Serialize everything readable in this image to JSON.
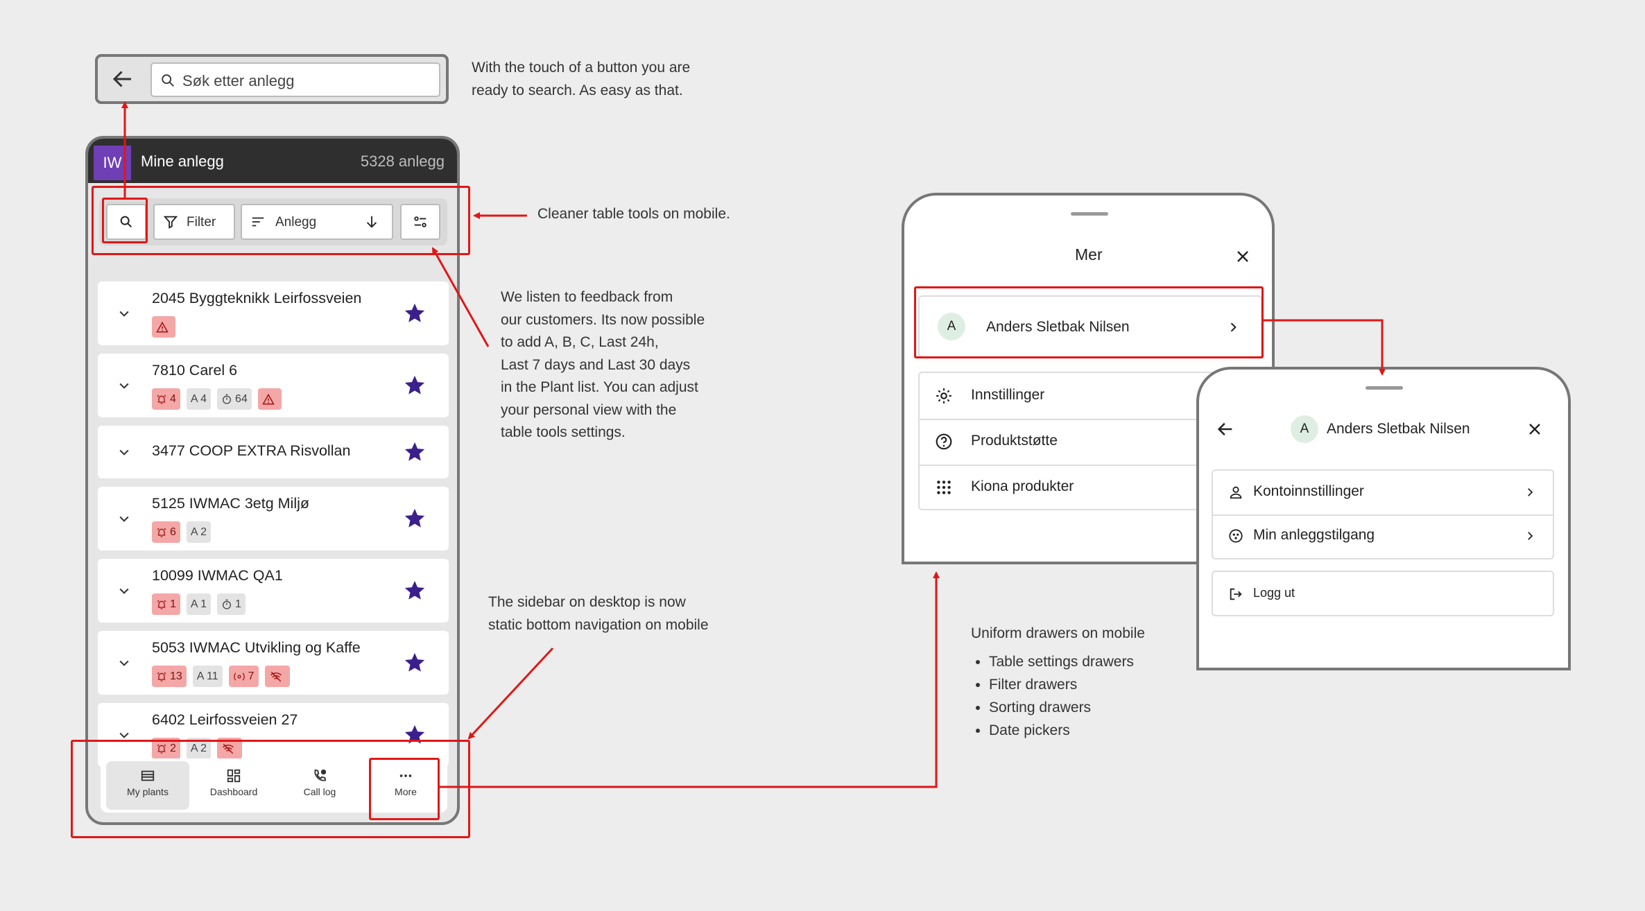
{
  "annotations": {
    "search": "With the touch of a button you are\nready to search. As easy as that.",
    "tools": "Cleaner table tools on mobile.",
    "feedback": "We listen to feedback from\nour customers. Its now possible\nto add A, B, C, Last 24h,\nLast 7 days and Last 30 days\nin the Plant list. You can adjust\nyour personal view with the\ntable tools settings.",
    "sidebar": "The sidebar on desktop is now\nstatic bottom navigation on mobile",
    "drawers_title": "Uniform drawers on mobile",
    "drawers_list": [
      "Table settings drawers",
      "Filter drawers",
      "Sorting drawers",
      "Date pickers"
    ]
  },
  "search": {
    "placeholder": "Søk etter anlegg"
  },
  "phone": {
    "logo": "IW",
    "title": "Mine anlegg",
    "count": "5328 anlegg",
    "filter_label": "Filter",
    "sort_label": "Anlegg",
    "plants": [
      {
        "name": "2045 Byggteknikk Leirfossveien",
        "badges": [
          {
            "style": "red",
            "icon": "warning-icon",
            "text": ""
          }
        ]
      },
      {
        "name": "7810 Carel 6",
        "badges": [
          {
            "style": "red",
            "icon": "alarm-icon",
            "text": "4"
          },
          {
            "style": "grey",
            "icon": "",
            "text": "A 4"
          },
          {
            "style": "grey",
            "icon": "timer-icon",
            "text": "64"
          },
          {
            "style": "red",
            "icon": "warning-icon",
            "text": ""
          }
        ]
      },
      {
        "name": "3477 COOP EXTRA Risvollan",
        "badges": []
      },
      {
        "name": "5125 IWMAC 3etg Miljø",
        "badges": [
          {
            "style": "red",
            "icon": "alarm-icon",
            "text": "6"
          },
          {
            "style": "grey",
            "icon": "",
            "text": "A 2"
          }
        ]
      },
      {
        "name": "10099 IWMAC QA1",
        "badges": [
          {
            "style": "red",
            "icon": "alarm-icon",
            "text": "1"
          },
          {
            "style": "grey",
            "icon": "",
            "text": "A 1"
          },
          {
            "style": "grey",
            "icon": "timer-icon",
            "text": "1"
          }
        ]
      },
      {
        "name": "5053 IWMAC Utvikling og Kaffe",
        "badges": [
          {
            "style": "red",
            "icon": "alarm-icon",
            "text": "13"
          },
          {
            "style": "grey",
            "icon": "",
            "text": "A 11"
          },
          {
            "style": "red",
            "icon": "sensor-icon",
            "text": "7"
          },
          {
            "style": "red",
            "icon": "wifi-off-icon",
            "text": ""
          }
        ]
      },
      {
        "name": "6402 Leirfossveien 27",
        "badges": [
          {
            "style": "red",
            "icon": "alarm-icon",
            "text": "2"
          },
          {
            "style": "grey",
            "icon": "",
            "text": "A 2"
          },
          {
            "style": "red",
            "icon": "wifi-off-icon",
            "text": ""
          }
        ]
      }
    ],
    "nav": [
      "My plants",
      "Dashboard",
      "Call log",
      "More"
    ]
  },
  "mer_drawer": {
    "title": "Mer",
    "user_initial": "A",
    "user_name": "Anders Sletbak Nilsen",
    "items": [
      "Innstillinger",
      "Produktstøtte",
      "Kiona produkter"
    ]
  },
  "user_drawer": {
    "user_initial": "A",
    "user_name": "Anders Sletbak Nilsen",
    "items": [
      "Kontoinnstillinger",
      "Min anleggstilgang"
    ],
    "logout": "Logg ut"
  },
  "colors": {
    "accent_red": "#e01717",
    "brand_purple": "#6f3fb5",
    "star": "#3b1f8c"
  }
}
